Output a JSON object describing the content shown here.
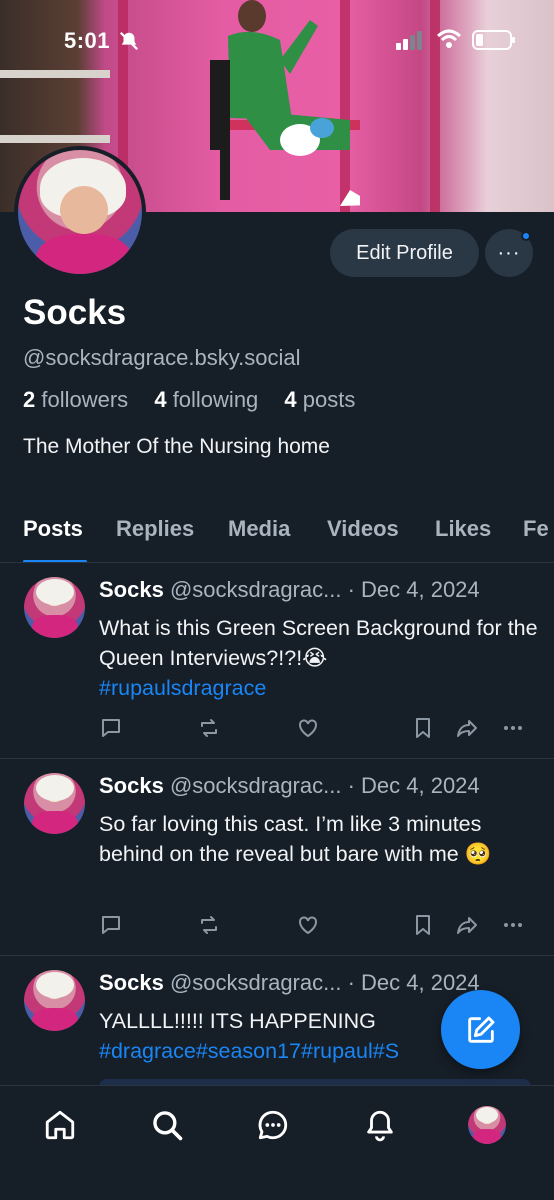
{
  "status_bar": {
    "time": "5:01"
  },
  "profile": {
    "name": "Socks",
    "handle": "@socksdragrace.bsky.social",
    "followers_count": "2",
    "followers_label": "followers",
    "following_count": "4",
    "following_label": "following",
    "posts_count": "4",
    "posts_label": "posts",
    "bio": "The Mother Of the Nursing home",
    "edit_label": "Edit Profile",
    "more_label": "···"
  },
  "tabs": [
    "Posts",
    "Replies",
    "Media",
    "Videos",
    "Likes",
    "Fe"
  ],
  "posts": [
    {
      "author": "Socks",
      "handle": "@socksdragrac...",
      "date": "· Dec 4, 2024",
      "text": "What is this Green Screen Background for the Queen Interviews?!?!😭",
      "tags": "#rupaulsdragrace"
    },
    {
      "author": "Socks",
      "handle": "@socksdragrac...",
      "date": "· Dec 4, 2024",
      "text": "So far loving this cast. I’m like 3 minutes behind on the reveal but bare with me 🥺",
      "tags": ""
    },
    {
      "author": "Socks",
      "handle": "@socksdragrac...",
      "date": "· Dec 4, 2024",
      "text": "YALLLL!!!!! ITS HAPPENING",
      "tags": "#dragrace#season17#rupaul#S"
    }
  ],
  "accent_color": "#1a86f5",
  "icons": {
    "compose": "compose-icon",
    "home": "home-icon",
    "search": "search-icon",
    "chat": "chat-icon",
    "notifications": "bell-icon"
  }
}
